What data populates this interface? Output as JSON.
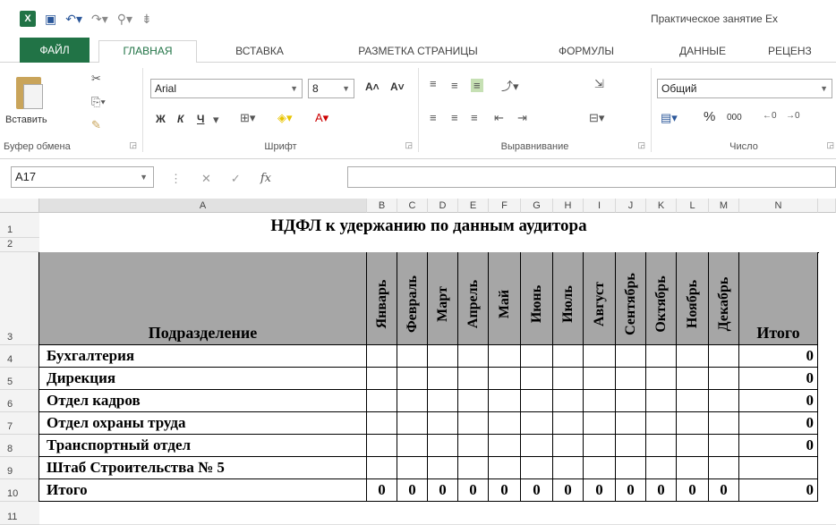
{
  "window": {
    "title": "Практическое занятие Ex"
  },
  "ribbon_tabs": [
    "ФАЙЛ",
    "ГЛАВНАЯ",
    "ВСТАВКА",
    "РАЗМЕТКА СТРАНИЦЫ",
    "ФОРМУЛЫ",
    "ДАННЫЕ",
    "РЕЦЕНЗ"
  ],
  "clipboard": {
    "paste": "Вставить",
    "group": "Буфер обмена"
  },
  "font": {
    "name": "Arial",
    "size": "8",
    "group": "Шрифт",
    "bold": "Ж",
    "italic": "К",
    "underline": "Ч"
  },
  "alignment": {
    "group": "Выравнивание"
  },
  "number": {
    "format": "Общий",
    "group": "Число",
    "percent": "%",
    "thousands": "000"
  },
  "formula_bar": {
    "name_box": "A17",
    "fx": "fx",
    "value": ""
  },
  "col_headers": [
    "A",
    "B",
    "C",
    "D",
    "E",
    "F",
    "G",
    "H",
    "I",
    "J",
    "K",
    "L",
    "M",
    "N"
  ],
  "row_headers": [
    "1",
    "2",
    "3",
    "4",
    "5",
    "6",
    "7",
    "8",
    "9",
    "10",
    "11"
  ],
  "sheet": {
    "title": "НДФЛ к удержанию по данным аудитора",
    "header_dept": "Подразделение",
    "months": [
      "Январь",
      "Февраль",
      "Март",
      "Апрель",
      "Май",
      "Июнь",
      "Июль",
      "Август",
      "Сентябрь",
      "Октябрь",
      "Ноябрь",
      "Декабрь"
    ],
    "header_total": "Итого",
    "rows": [
      {
        "name": "Бухгалтерия",
        "total": "0"
      },
      {
        "name": "Дирекция",
        "total": "0"
      },
      {
        "name": "Отдел кадров",
        "total": "0"
      },
      {
        "name": "Отдел охраны труда",
        "total": "0"
      },
      {
        "name": "Транспортный отдел",
        "total": "0"
      },
      {
        "name": "Штаб Строительства № 5",
        "total": ""
      }
    ],
    "total_row": {
      "label": "Итого",
      "values": [
        "0",
        "0",
        "0",
        "0",
        "0",
        "0",
        "0",
        "0",
        "0",
        "0",
        "0",
        "0"
      ],
      "total": "0"
    }
  }
}
